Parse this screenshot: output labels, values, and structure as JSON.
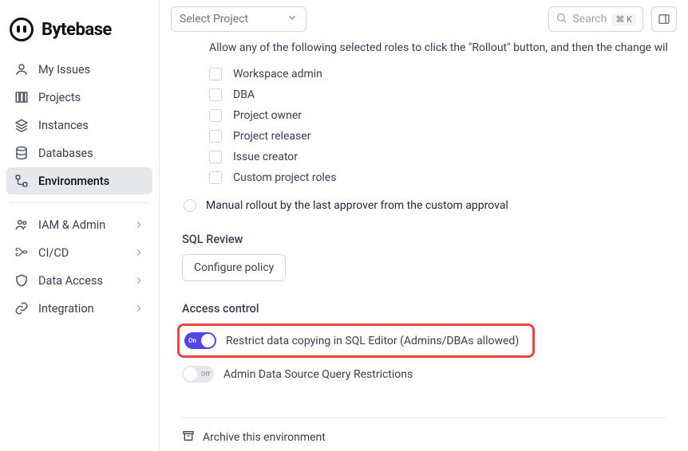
{
  "brand": "Bytebase",
  "topbar": {
    "select_project": "Select Project",
    "search": "Search",
    "kbd": "⌘ K"
  },
  "sidebar": {
    "items": [
      {
        "label": "My Issues"
      },
      {
        "label": "Projects"
      },
      {
        "label": "Instances"
      },
      {
        "label": "Databases"
      },
      {
        "label": "Environments"
      }
    ],
    "lower": [
      {
        "label": "IAM & Admin"
      },
      {
        "label": "CI/CD"
      },
      {
        "label": "Data Access"
      },
      {
        "label": "Integration"
      }
    ]
  },
  "main": {
    "rollout_desc": "Allow any of the following selected roles to click the \"Rollout\" button, and then the change wil",
    "roles": [
      "Workspace admin",
      "DBA",
      "Project owner",
      "Project releaser",
      "Issue creator",
      "Custom project roles"
    ],
    "manual_rollout": "Manual rollout by the last approver from the custom approval",
    "sql_review_h": "SQL Review",
    "configure_policy": "Configure policy",
    "access_control_h": "Access control",
    "restrict_copy": "Restrict data copying in SQL Editor (Admins/DBAs allowed)",
    "admin_restrict": "Admin Data Source Query Restrictions",
    "toggle_on": "On",
    "toggle_off": "Off",
    "archive": "Archive this environment"
  }
}
